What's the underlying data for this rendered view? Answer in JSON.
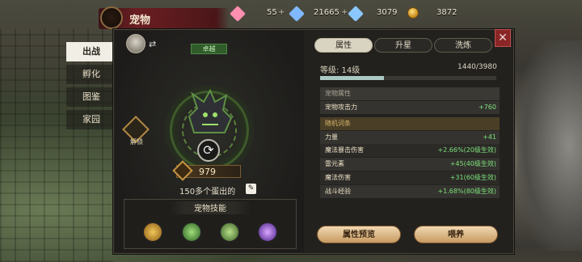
{
  "header": {
    "title": "宠物"
  },
  "resources": [
    {
      "value": "55",
      "color": "#ff8fb0"
    },
    {
      "value": "21665",
      "color": "#7fb8ff"
    },
    {
      "value": "3079",
      "color": "#8ac8ff"
    },
    {
      "value": "3872",
      "color": "#e0a030"
    }
  ],
  "side_tabs": [
    "出战",
    "孵化",
    "图鉴",
    "家园"
  ],
  "pet": {
    "rarity": "卓越",
    "unlock": "解锁",
    "power": "979",
    "eggs": "150多个蛋出的",
    "skills_title": "宠物技能",
    "skills": [
      {
        "icon": "gold-shield-skill-icon",
        "color": "#c8962e"
      },
      {
        "icon": "green-claw-skill-icon",
        "color": "#3c8a3a"
      },
      {
        "icon": "leaf-skill-icon",
        "color": "#4e8a3a"
      },
      {
        "icon": "purple-vortex-skill-icon",
        "color": "#7a4ac8"
      }
    ]
  },
  "tabs": [
    "属性",
    "升星",
    "洗炼"
  ],
  "level": {
    "label": "等级:  14级",
    "exp": "1440/3980",
    "progress": 0.362
  },
  "attributes": {
    "header": "宠物属性",
    "main": {
      "name": "宠物攻击力",
      "value": "+760"
    },
    "random_header": "随机词条",
    "entries": [
      {
        "name": "力量",
        "value": "+41"
      },
      {
        "name": "魔法暴击伤害",
        "value": "+2.66%(20级生效)"
      },
      {
        "name": "雷元素",
        "value": "+45(40级生效)"
      },
      {
        "name": "魔法伤害",
        "value": "+31(60级生效)"
      },
      {
        "name": "战斗经验",
        "value": "+1.68%(80级生效)"
      }
    ]
  },
  "buttons": {
    "preview": "属性预览",
    "feed": "喂养"
  },
  "colors": {
    "accent_green": "#7ee07a",
    "panel": "#22211e",
    "close": "#8a2626"
  }
}
